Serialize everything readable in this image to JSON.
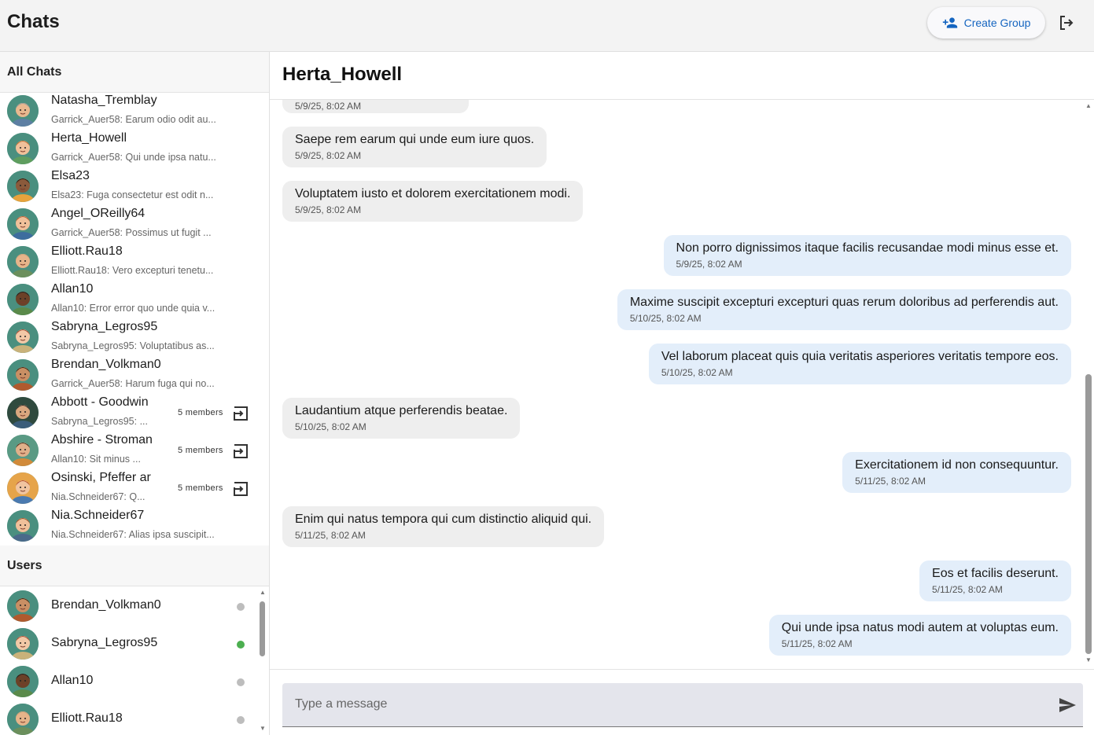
{
  "app": {
    "title": "Chats"
  },
  "header": {
    "create_group_label": "Create Group"
  },
  "sidebar": {
    "all_chats_label": "All Chats",
    "users_label": "Users",
    "chats": [
      {
        "name": "Natasha_Tremblay",
        "preview": "Garrick_Auer58: Earum odio odit au...",
        "avatar": "man-bald-mustache"
      },
      {
        "name": "Herta_Howell",
        "preview": "Garrick_Auer58: Qui unde ipsa natu...",
        "avatar": "man-ginger"
      },
      {
        "name": "Elsa23",
        "preview": "Elsa23: Fuga consectetur est odit n...",
        "avatar": "woman-dark"
      },
      {
        "name": "Angel_OReilly64",
        "preview": "Garrick_Auer58: Possimus ut fugit ...",
        "avatar": "man-ginger-2"
      },
      {
        "name": "Elliott.Rau18",
        "preview": "Elliott.Rau18: Vero excepturi tenetu...",
        "avatar": "man-bald-glasses"
      },
      {
        "name": "Allan10",
        "preview": "Allan10: Error error quo unde quia v...",
        "avatar": "man-dark"
      },
      {
        "name": "Sabryna_Legros95",
        "preview": "Sabryna_Legros95: Voluptatibus as...",
        "avatar": "woman-red"
      },
      {
        "name": "Brendan_Volkman0",
        "preview": "Garrick_Auer58: Harum fuga qui no...",
        "avatar": "man-brown"
      },
      {
        "name": "Abbott - Goodwin",
        "preview": "Sabryna_Legros95: ...",
        "members": "5 members",
        "avatar": "group-1"
      },
      {
        "name": "Abshire - Stroman",
        "preview": "Allan10: Sit minus ...",
        "members": "5 members",
        "avatar": "group-2"
      },
      {
        "name": "Osinski, Pfeffer ar",
        "preview": "Nia.Schneider67: Q...",
        "members": "5 members",
        "avatar": "group-3"
      },
      {
        "name": "Nia.Schneider67",
        "preview": "Nia.Schneider67: Alias ipsa suscipit...",
        "avatar": "man-ginger-3"
      }
    ],
    "users": [
      {
        "name": "Brendan_Volkman0",
        "status": "offline",
        "status_color": "#bdbdbd"
      },
      {
        "name": "Sabryna_Legros95",
        "status": "online",
        "status_color": "#4caf50"
      },
      {
        "name": "Allan10",
        "status": "offline",
        "status_color": "#bdbdbd"
      },
      {
        "name": "Elliott.Rau18",
        "status": "offline",
        "status_color": "#bdbdbd"
      }
    ]
  },
  "chat": {
    "title": "Herta_Howell",
    "partial_time": "5/9/25, 8:02 AM",
    "messages": [
      {
        "dir": "in",
        "text": "Saepe rem earum qui unde eum iure quos.",
        "time": "5/9/25, 8:02 AM"
      },
      {
        "dir": "in",
        "text": "Voluptatem iusto et dolorem exercitationem modi.",
        "time": "5/9/25, 8:02 AM"
      },
      {
        "dir": "out",
        "text": "Non porro dignissimos itaque facilis recusandae modi minus esse et.",
        "time": "5/9/25, 8:02 AM"
      },
      {
        "dir": "out",
        "text": "Maxime suscipit excepturi excepturi quas rerum doloribus ad perferendis aut.",
        "time": "5/10/25, 8:02 AM"
      },
      {
        "dir": "out",
        "text": "Vel laborum placeat quis quia veritatis asperiores veritatis tempore eos.",
        "time": "5/10/25, 8:02 AM"
      },
      {
        "dir": "in",
        "text": "Laudantium atque perferendis beatae.",
        "time": "5/10/25, 8:02 AM"
      },
      {
        "dir": "out",
        "text": "Exercitationem id non consequuntur.",
        "time": "5/11/25, 8:02 AM"
      },
      {
        "dir": "in",
        "text": "Enim qui natus tempora qui cum distinctio aliquid qui.",
        "time": "5/11/25, 8:02 AM"
      },
      {
        "dir": "out",
        "text": "Eos et facilis deserunt.",
        "time": "5/11/25, 8:02 AM"
      },
      {
        "dir": "out",
        "text": "Qui unde ipsa natus modi autem at voluptas eum.",
        "time": "5/11/25, 8:02 AM"
      }
    ]
  },
  "composer": {
    "placeholder": "Type a message"
  },
  "colors": {
    "accent": "#1565c0",
    "incoming_bubble": "#eeeeee",
    "outgoing_bubble": "#e3eefa",
    "online": "#4caf50",
    "offline": "#bdbdbd"
  }
}
